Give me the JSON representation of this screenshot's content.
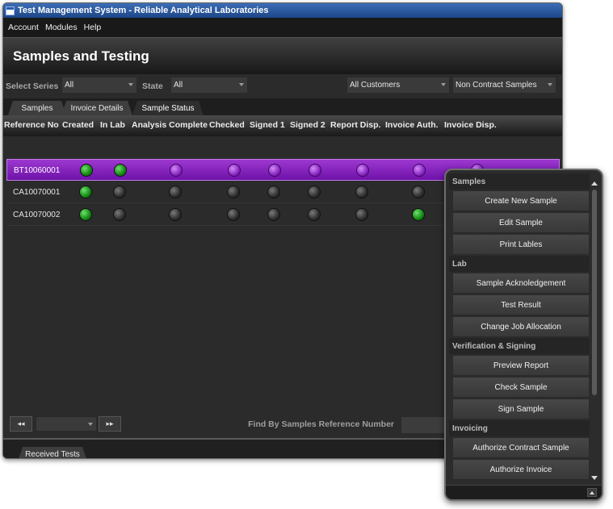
{
  "window": {
    "title": "Test Management System - Reliable Analytical Laboratories"
  },
  "menu": [
    "Account",
    "Modules",
    "Help"
  ],
  "page_title": "Samples and Testing",
  "filters": {
    "series_label": "Select Series",
    "series_value": "All",
    "state_label": "State",
    "state_value": "All",
    "customers_value": "All Customers",
    "contract_value": "Non Contract Samples"
  },
  "tabs": [
    "Samples",
    "Invoice Details",
    "Sample Status"
  ],
  "columns": [
    "Reference No",
    "Created",
    "In Lab",
    "Analysis Complete",
    "Checked",
    "Signed 1",
    "Signed 2",
    "Report Disp.",
    "Invoice Auth.",
    "Invoice Disp."
  ],
  "rows": [
    {
      "ref": "BT10060001",
      "selected": true,
      "status": [
        "green",
        "green",
        "purple",
        "purple",
        "purple",
        "purple",
        "purple",
        "purple",
        "purple"
      ]
    },
    {
      "ref": "CA10070001",
      "selected": false,
      "status": [
        "green",
        "grey",
        "grey",
        "grey",
        "grey",
        "grey",
        "grey",
        "grey",
        "grey"
      ]
    },
    {
      "ref": "CA10070002",
      "selected": false,
      "status": [
        "green",
        "grey",
        "grey",
        "grey",
        "grey",
        "grey",
        "grey",
        "green",
        "grey"
      ]
    }
  ],
  "pager": {
    "prev": "◂◂",
    "next": "▸▸",
    "find_label": "Find By Samples Reference Number"
  },
  "bottom_tab": "Received Tests",
  "panel": {
    "sections": [
      {
        "title": "Samples",
        "items": [
          "Create New Sample",
          "Edit Sample",
          "Print Lables"
        ]
      },
      {
        "title": "Lab",
        "items": [
          "Sample Acknoledgement",
          "Test Result",
          "Change Job Allocation"
        ]
      },
      {
        "title": "Verification & Signing",
        "items": [
          "Preview Report",
          "Check Sample",
          "Sign Sample"
        ]
      },
      {
        "title": "Invoicing",
        "items": [
          "Authorize Contract Sample",
          "Authorize Invoice"
        ]
      }
    ]
  },
  "colors": {
    "selected_row": "#8a28c3",
    "green_status": "#128812",
    "title_bar": "#2a5da8"
  }
}
